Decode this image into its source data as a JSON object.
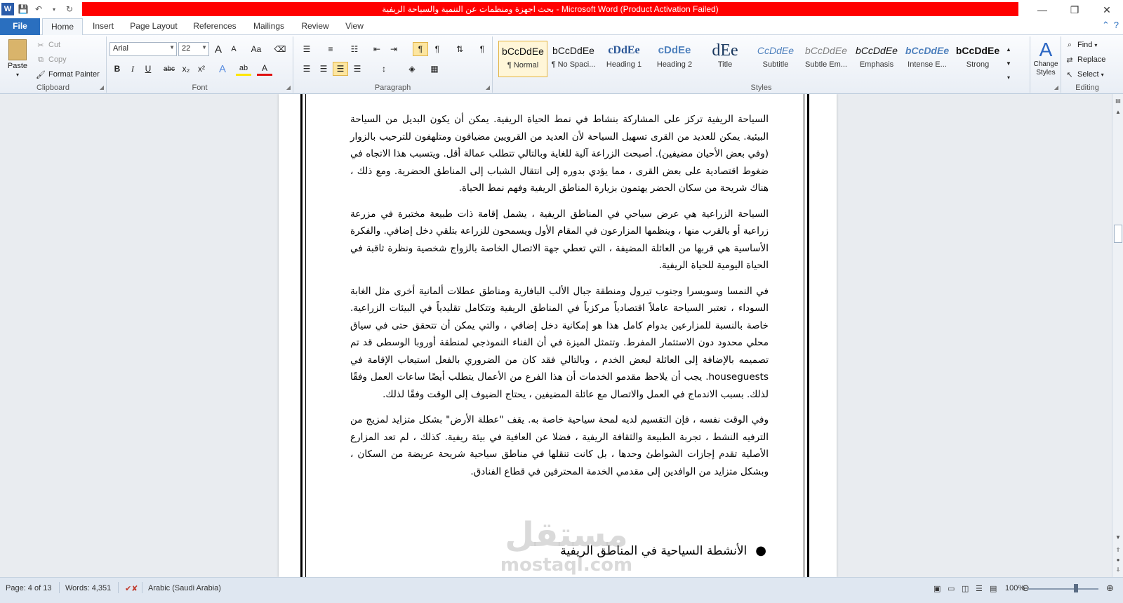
{
  "window": {
    "title": "بحث اجهزة ومنظمات عن التنمية والسياحة الريفية  -  Microsoft Word (Product Activation Failed)",
    "minimize": "—",
    "maximize": "❐",
    "close": "✕"
  },
  "tabs": [
    "File",
    "Home",
    "Insert",
    "Page Layout",
    "References",
    "Mailings",
    "Review",
    "View"
  ],
  "clipboard": {
    "paste": "Paste",
    "cut": "Cut",
    "copy": "Copy",
    "format_painter": "Format Painter",
    "label": "Clipboard"
  },
  "font": {
    "name": "Arial",
    "size": "22",
    "label": "Font",
    "grow": "A",
    "shrink": "A",
    "case": "Aa",
    "bold": "B",
    "italic": "I",
    "underline": "U",
    "strike": "abc",
    "subscript": "x₂",
    "superscript": "x²",
    "effects": "A",
    "highlight": "ab",
    "color": "A"
  },
  "paragraph": {
    "label": "Paragraph"
  },
  "styles": {
    "label": "Styles",
    "items": [
      {
        "preview": "bCcDdEe",
        "name": "¶ Normal"
      },
      {
        "preview": "bCcDdEe",
        "name": "¶ No Spaci..."
      },
      {
        "preview": "cDdEe",
        "name": "Heading 1"
      },
      {
        "preview": "cDdEe",
        "name": "Heading 2"
      },
      {
        "preview": "dEe",
        "name": "Title"
      },
      {
        "preview": "CcDdEe",
        "name": "Subtitle"
      },
      {
        "preview": "bCcDdEe",
        "name": "Subtle Em..."
      },
      {
        "preview": "bCcDdEe",
        "name": "Emphasis"
      },
      {
        "preview": "bCcDdEe",
        "name": "Intense E..."
      },
      {
        "preview": "bCcDdEe",
        "name": "Strong"
      }
    ],
    "change_styles": "Change Styles"
  },
  "editing": {
    "label": "Editing",
    "find": "Find",
    "replace": "Replace",
    "select": "Select"
  },
  "document": {
    "paragraphs": [
      "السياحة الريفية تركز على المشاركة بنشاط في نمط الحياة الريفية. يمكن أن يكون البديل من السياحة البيئية. يمكن للعديد من القرى تسهيل السياحة لأن العديد من القرويين مضيافون ومتلهفون للترحيب بالزوار (وفي بعض الأحيان مضيفين). أصبحت الزراعة آلية للغاية وبالتالي تتطلب عمالة أقل. ويتسبب هذا الاتجاه في ضغوط اقتصادية على بعض القرى ، مما يؤدي بدوره إلى انتقال الشباب إلى المناطق الحضرية. ومع ذلك ، هناك شريحة من سكان الحضر يهتمون بزيارة المناطق الريفية وفهم نمط الحياة.",
      "السياحة الزراعية هي عرض سياحي في المناطق الريفية ، يشمل إقامة ذات طبيعة مختبرة في مزرعة زراعية أو بالقرب منها ، وينظمها المزارعون في المقام الأول ويسمحون للزراعة بتلقي دخل إضافي. والفكرة الأساسية هي قربها من العائلة المضيفة ، التي تعطي جهة الاتصال الخاصة بالزواج شخصية ونظرة ثاقبة في الحياة اليومية للحياة الريفية.",
      "في النمسا وسويسرا وجنوب تيرول ومنطقة جبال الألب البافارية ومناطق عطلات ألمانية أخرى مثل الغابة السوداء ، تعتبر السياحة عاملاً اقتصادياً مركزياً في المناطق الريفية وتتكامل تقليدياً في البيئات الزراعية. خاصة بالنسبة للمزارعين بدوام كامل هذا هو إمكانية دخل إضافي ، والتي يمكن أن تتحقق حتى في سياق محلي محدود دون الاستثمار المفرط. وتتمثل الميزة في أن الفناء النموذجي لمنطقة أوروبا الوسطى قد تم تصميمه بالإضافة إلى العائلة لبعض الخدم ، وبالتالي فقد كان من الضروري بالفعل استيعاب الإقامة في houseguests. يجب أن يلاحظ مقدمو الخدمات أن هذا الفرع من الأعمال يتطلب أيضًا ساعات العمل وفقًا لذلك. بسبب الاندماج في العمل والاتصال مع عائلة المضيفين ، يحتاج الضيوف إلى الوقت وفقًا لذلك.",
      "وفي الوقت نفسه ، فإن التقسيم لديه لمحة سياحية خاصة به. يقف \"عطلة الأرض\" بشكل متزايد لمزيج من الترفيه النشط ، تجربة الطبيعة والثقافة الريفية ، فضلا عن العافية في بيئة ريفية. كذلك ، لم تعد المزارع الأصلية تقدم إجازات الشواطئ وحدها ، بل كانت تنقلها في مناطق سياحية شريحة عريضة من السكان ، وبشكل متزايد من الوافدين إلى مقدمي الخدمة المحترفين في قطاع الفنادق."
    ],
    "bullet_heading": "الأنشطة السياحية في المناطق الريفية",
    "watermark_top": "مستقل",
    "watermark_bottom": "mostaql.com"
  },
  "statusbar": {
    "page": "Page: 4 of 13",
    "words": "Words: 4,351",
    "language": "Arabic (Saudi Arabia)",
    "zoom": "100%",
    "zoom_level": 1.0
  }
}
